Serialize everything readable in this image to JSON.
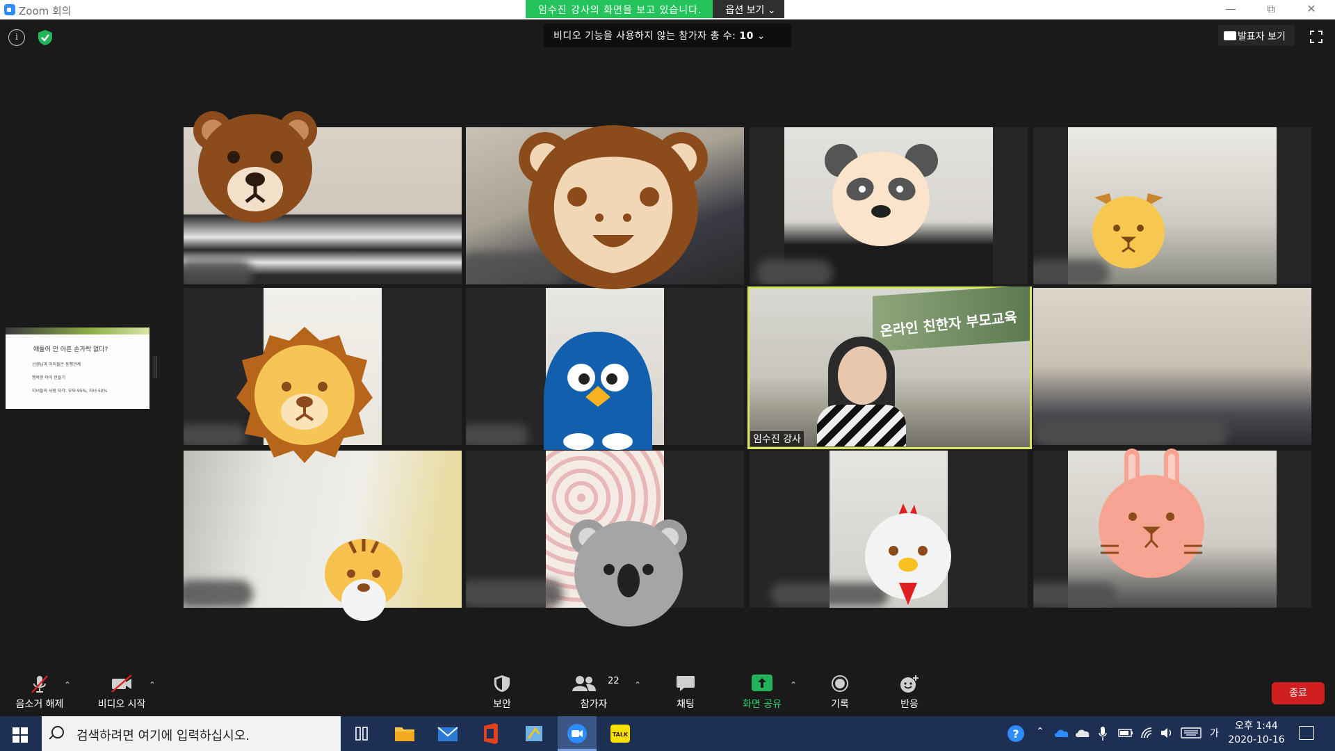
{
  "window": {
    "title": "Zoom 회의"
  },
  "banner": {
    "message": "임수진 강사의 화면을 보고 있습니다.",
    "options": "옵션 보기 ⌄"
  },
  "header": {
    "nonvideo_label": "비디오 기능을 사용하지 않는 참가자 총 수: ",
    "nonvideo_count": "10",
    "speaker_view": "발표자 보기"
  },
  "shared_screen": {
    "heading": "애들이 안 아픈 손가락 없다?",
    "lines": [
      "선생님과 아이들은 동행관계",
      "행복한 아이 만들기",
      "자녀들의 사랑 자각: 부모 95%, 자녀 50%"
    ]
  },
  "tiles": {
    "active_name": "임수진 강사",
    "banner_text": "온라인 친한자 부모교육"
  },
  "toolbar": {
    "mute": "음소거 해제",
    "video": "비디오 시작",
    "security": "보안",
    "participants": "참가자",
    "participants_count": "22",
    "chat": "채팅",
    "share": "화면 공유",
    "record": "기록",
    "reactions": "반응",
    "end": "종료"
  },
  "taskbar": {
    "search_placeholder": "검색하려면 여기에 입력하십시오.",
    "ime": "가",
    "time": "오후 1:44",
    "date": "2020-10-16"
  },
  "colors": {
    "share_green": "#24c35c",
    "active_border": "#d8e85a",
    "end_red": "#d01f1f",
    "taskbar": "#1d2f52"
  }
}
